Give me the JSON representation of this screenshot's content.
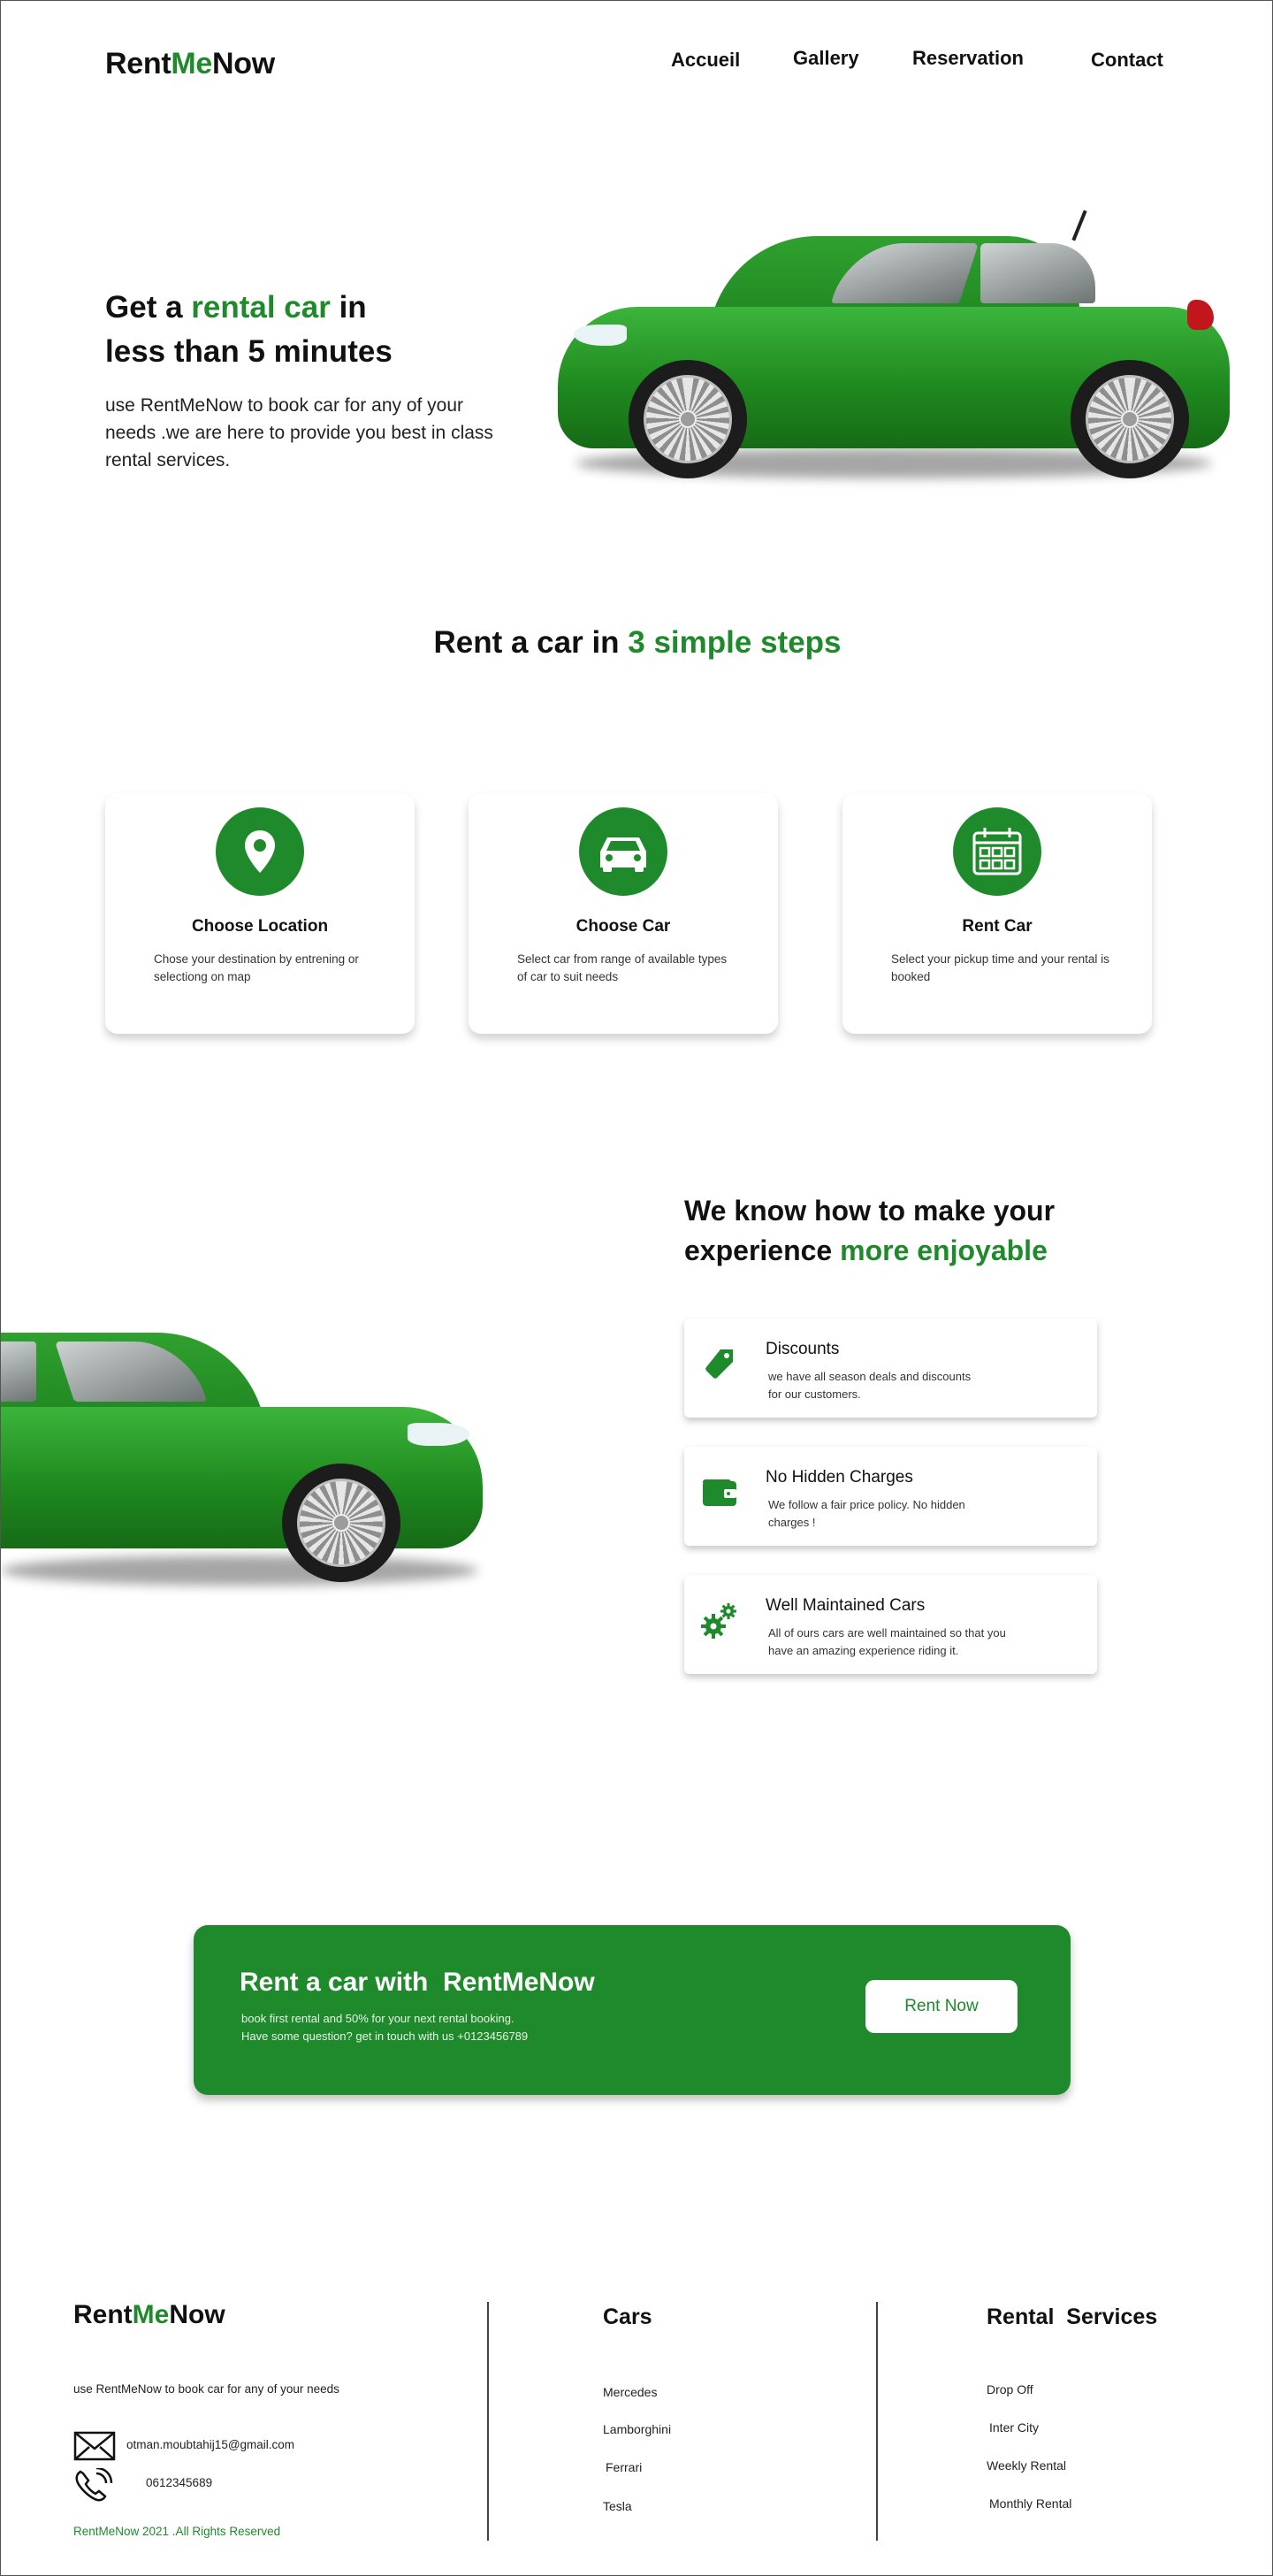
{
  "nav": {
    "logo_part1": "Rent",
    "logo_part2": "Me",
    "logo_part3": "Now",
    "links": [
      "Accueil",
      "Gallery",
      "Reservation",
      "Contact"
    ]
  },
  "hero": {
    "title_part1": "Get a ",
    "title_highlight": "rental car",
    "title_part2": " in",
    "title_line2": "less than 5 minutes",
    "description": "use RentMeNow to book car for any of your needs .we are here to provide you best in class rental services."
  },
  "steps": {
    "title_part1": "Rent a car in ",
    "title_highlight": "3 simple steps",
    "items": [
      {
        "title": "Choose Location",
        "description": "Chose your destination by entrening or selectiong on map",
        "icon": "location-pin-icon"
      },
      {
        "title": "Choose Car",
        "description": "Select car from range of available types of car to suit needs",
        "icon": "car-icon"
      },
      {
        "title": "Rent Car",
        "description": "Select your pickup time and your rental is booked",
        "icon": "calendar-icon"
      }
    ]
  },
  "features": {
    "title_line1": "We know how to make your",
    "title_part2": "experience ",
    "title_highlight": "more enjoyable",
    "items": [
      {
        "title": "Discounts",
        "description": "we have all season deals and discounts for our customers.",
        "icon": "tag-icon"
      },
      {
        "title": "No Hidden Charges",
        "description": "We follow a fair price policy. No hidden charges !",
        "icon": "wallet-icon"
      },
      {
        "title": "Well Maintained Cars",
        "description": "All of ours cars are well maintained so that you have an amazing experience riding it.",
        "icon": "gears-icon"
      }
    ]
  },
  "cta": {
    "title": "Rent a car with  RentMeNow",
    "line1": "book first rental and 50% for your next rental booking.",
    "line2": "Have some question? get in touch with us +0123456789",
    "button": "Rent Now"
  },
  "footer": {
    "logo_part1": "Rent",
    "logo_part2": "Me",
    "logo_part3": "Now",
    "tagline": "use RentMeNow to book car for any of your needs",
    "email": "otman.moubtahij15@gmail.com",
    "phone": "0612345689",
    "copyright": "RentMeNow 2021 .All Rights Reserved",
    "cars_title": "Cars",
    "cars": [
      "Mercedes",
      "Lamborghini",
      "Ferrari",
      "Tesla"
    ],
    "services_title": "Rental  Services",
    "services": [
      "Drop Off",
      "Inter City",
      "Weekly Rental",
      "Monthly Rental"
    ]
  },
  "colors": {
    "accent": "#1f8a2c",
    "text": "#111111",
    "background": "#ffffff"
  }
}
